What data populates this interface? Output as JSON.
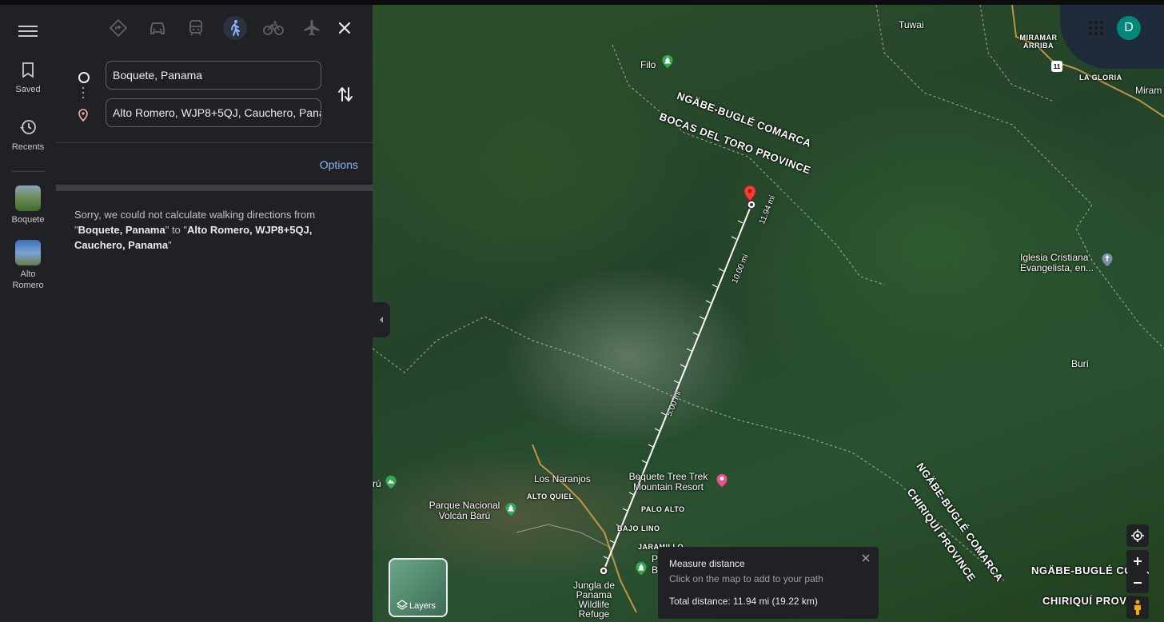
{
  "rail": {
    "saved_label": "Saved",
    "recents_label": "Recents",
    "places": [
      {
        "label": "Boquete"
      },
      {
        "label": "Alto Romero"
      }
    ]
  },
  "directions": {
    "modes": [
      "best-route",
      "driving",
      "transit",
      "walking",
      "cycling",
      "flights"
    ],
    "active_mode": "walking",
    "origin": "Boquete, Panama",
    "destination": "Alto Romero, WJP8+5QJ, Cauchero, Panama",
    "options_label": "Options",
    "error": {
      "prefix": "Sorry, we could not calculate walking directions from \"",
      "origin": "Boquete, Panama",
      "mid": "\" to \"",
      "destination": "Alto Romero, WJP8+5QJ, Cauchero, Panama",
      "suffix": "\""
    }
  },
  "map": {
    "labels": {
      "tuwai": "Tuwai",
      "miramar": "MIRAMAR ARRIBA",
      "la_gloria": "LA GLORIA",
      "miram": "Miram",
      "filo": "Filo",
      "ngabe1": "NGÄBE-BUGLÉ COMARCA",
      "bocas": "BOCAS DEL TORO PROVINCE",
      "iglesia": "Iglesia Cristiana Evangelista, en...",
      "buri": "Burí",
      "ngabe2": "NGÄBE-BUGLÉ COMARCA",
      "chiriqui1": "CHIRIQUÍ PROVINCE",
      "ngabe3": "NGÄBE-BUGLÉ COMA",
      "chiriqui2": "CHIRIQUÍ PROVIN",
      "los_naranjos": "Los Naranjos",
      "alto_quiel": "ALTO QUIEL",
      "parque": "Parque Nacional Volcán Barú",
      "ru": "rú",
      "tree_trek": "Boquete Tree Trek Mountain Resort",
      "palo_alto": "PALO ALTO",
      "bajo_lino": "BAJO LINO",
      "jaramillo": "JARAMILLO",
      "jungla": "Jungla de Panama Wildlife Refuge",
      "p": "P",
      "b": "B",
      "road_number": "11"
    },
    "distance_marks": [
      "5.00 mi",
      "10.00 mi",
      "11.94 mi"
    ],
    "layers_label": "Layers",
    "avatar_initial": "D"
  },
  "measure": {
    "title": "Measure distance",
    "hint": "Click on the map to add to your path",
    "total": "Total distance: 11.94 mi (19.22 km)"
  }
}
